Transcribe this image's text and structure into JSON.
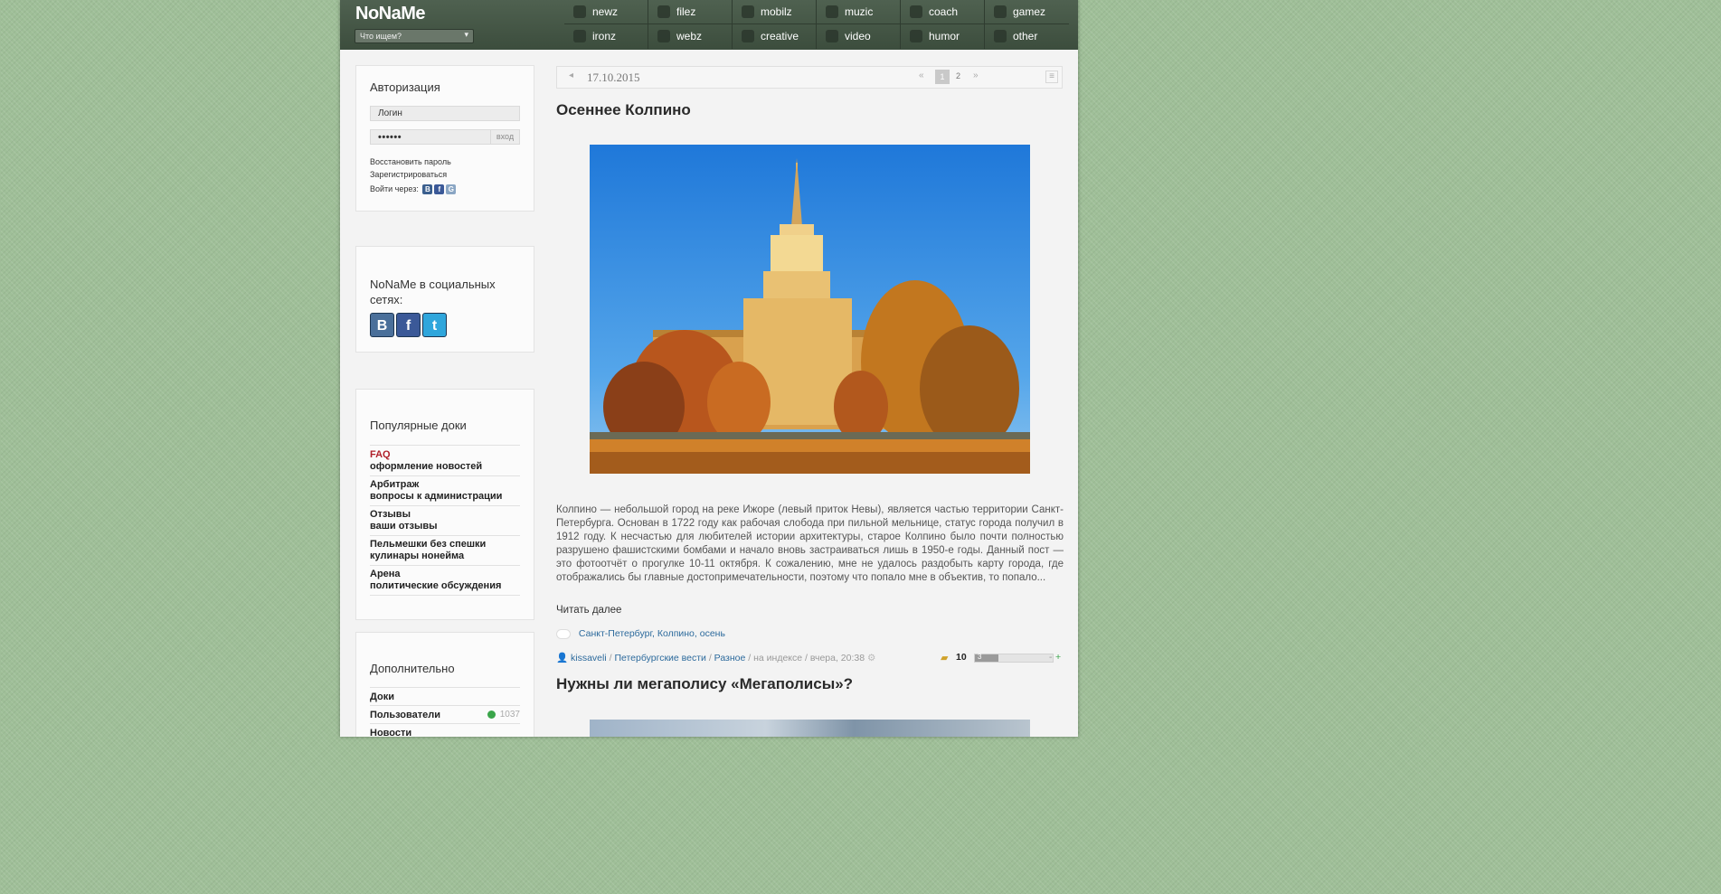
{
  "header": {
    "logo": "NoNaMe",
    "search_placeholder": "Что ищем?",
    "nav": [
      {
        "label": "newz"
      },
      {
        "label": "filez"
      },
      {
        "label": "mobilz"
      },
      {
        "label": "muzic"
      },
      {
        "label": "coach"
      },
      {
        "label": "gamez"
      },
      {
        "label": "ironz"
      },
      {
        "label": "webz"
      },
      {
        "label": "creative"
      },
      {
        "label": "video"
      },
      {
        "label": "humor"
      },
      {
        "label": "other"
      }
    ]
  },
  "auth": {
    "title": "Авторизация",
    "login_placeholder": "Логин",
    "password_value": "••••••",
    "submit": "вход",
    "restore": "Восстановить пароль",
    "register": "Зарегистрироваться",
    "login_via": "Войти через:",
    "providers": [
      {
        "icon": "vk-icon",
        "glyph": "В",
        "color": "#3b5f8e"
      },
      {
        "icon": "facebook-icon",
        "glyph": "f",
        "color": "#3b5998"
      },
      {
        "icon": "google-icon",
        "glyph": "G",
        "color": "#8aa6c4"
      }
    ]
  },
  "social": {
    "title_line1": "NoNaMe в социальных",
    "title_line2": "сетях:",
    "icons": [
      {
        "icon": "vk-icon",
        "glyph": "В",
        "color": "#4a6f9a"
      },
      {
        "icon": "facebook-icon",
        "glyph": "f",
        "color": "#3b5998"
      },
      {
        "icon": "twitter-icon",
        "glyph": "t",
        "color": "#2fa6dc"
      }
    ]
  },
  "popular": {
    "title": "Популярные доки",
    "items": [
      {
        "title": "FAQ",
        "subtitle": "оформление новостей",
        "highlight": true
      },
      {
        "title": "Арбитраж",
        "subtitle": "вопросы к администрации"
      },
      {
        "title": "Отзывы",
        "subtitle": "ваши отзывы"
      },
      {
        "title": "Пельмешки без спешки",
        "subtitle": "кулинары нонейма"
      },
      {
        "title": "Арена",
        "subtitle": "политические обсуждения"
      }
    ]
  },
  "extra": {
    "title": "Дополнительно",
    "items": [
      {
        "label": "Доки",
        "count": ""
      },
      {
        "label": "Пользователи",
        "count": "1037"
      },
      {
        "label": "Новости",
        "count": ""
      }
    ]
  },
  "datebar": {
    "date": "17.10.2015",
    "pages": [
      "1",
      "2"
    ],
    "current_page": "1"
  },
  "post1": {
    "title": "Осеннее Колпино",
    "text": "Колпино — небольшой город на реке Ижоре (левый приток Невы), является частью территории Санкт-Петербурга. Основан в 1722 году как рабочая слобода при пильной мельнице, статус города получил в 1912 году. К несчастью для любителей истории архитектуры, старое Колпино было почти полностью разрушено фашистскими бомбами и начало вновь застраиваться лишь в 1950-е годы. Данный пост — это фотоотчёт о прогулке 10-11 октября. К сожалению, мне не удалось раздобыть карту города, где отображались бы главные достопримечательности, поэтому что попало мне в объектив, то попало...",
    "read_more": "Читать далее",
    "tags": [
      "Санкт-Петербург",
      "Колпино",
      "осень"
    ],
    "author": "kissaveli",
    "categories": [
      "Петербургские вести",
      "Разное"
    ],
    "status": "на индексе",
    "time": "вчера, 20:38",
    "comments": "10",
    "rating": "3",
    "rating_minus": "-",
    "rating_plus": "+"
  },
  "post2": {
    "title": "Нужны ли мегаполису «Мегаполисы»?"
  },
  "colors": {
    "header_bg": "#45574a",
    "accent_red": "#b0202a",
    "link_blue": "#2c6a9c"
  }
}
